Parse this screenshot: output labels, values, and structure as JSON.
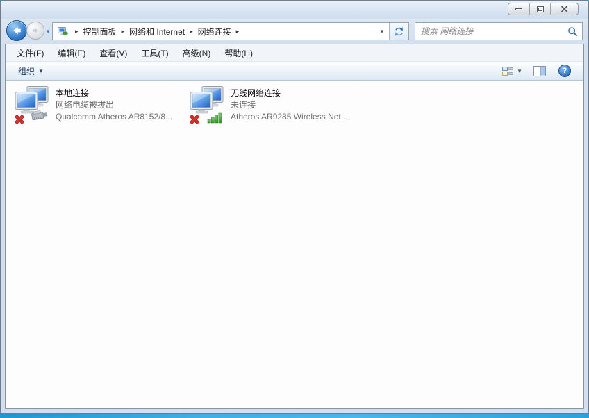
{
  "titlebar": {
    "controls": [
      "minimize",
      "maximize",
      "close"
    ]
  },
  "breadcrumb": {
    "items": [
      "控制面板",
      "网络和 Internet",
      "网络连接"
    ],
    "separator": "▸"
  },
  "search": {
    "placeholder": "搜索 网络连接"
  },
  "menubar": {
    "items": [
      "文件(F)",
      "编辑(E)",
      "查看(V)",
      "工具(T)",
      "高级(N)",
      "帮助(H)"
    ]
  },
  "toolbar": {
    "organize_label": "组织"
  },
  "icons": {
    "back": "left-arrow",
    "forward": "right-arrow",
    "small_dropdown": "▾",
    "dropdown_arrow": "▼",
    "refresh": "refresh-arrows",
    "search": "magnifier",
    "views": "list-view",
    "preview": "preview-pane",
    "help": "?"
  },
  "connections": [
    {
      "name": "本地连接",
      "status": "网络电缆被拔出",
      "device": "Qualcomm Atheros AR8152/8...",
      "kind": "ethernet"
    },
    {
      "name": "无线网络连接",
      "status": "未连接",
      "device": "Atheros AR9285 Wireless Net...",
      "kind": "wireless"
    }
  ],
  "colors": {
    "frame": "#d2dfee",
    "desktop": "#3fb0e2",
    "screen_blue": "#2a6cc8",
    "signal_green": "#58b74a",
    "error_red": "#d4372c"
  }
}
